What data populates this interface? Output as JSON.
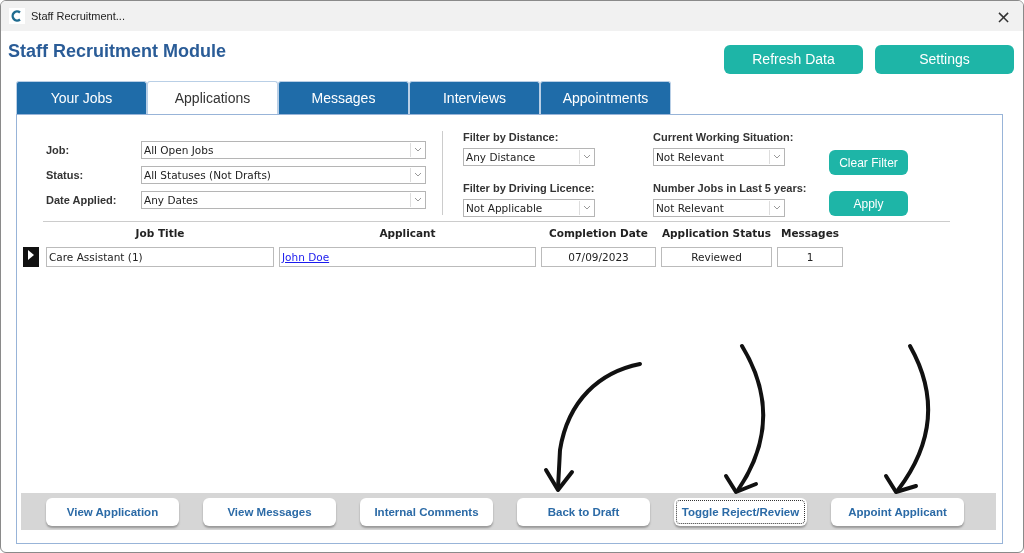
{
  "window": {
    "title": "Staff Recruitment...",
    "close": "×"
  },
  "header": {
    "title": "Staff Recruitment Module",
    "buttons": [
      "Refresh Data",
      "Settings"
    ]
  },
  "tabs": [
    {
      "label": "Your Jobs",
      "selected": false
    },
    {
      "label": "Applications",
      "selected": true
    },
    {
      "label": "Messages",
      "selected": false
    },
    {
      "label": "Interviews",
      "selected": false
    },
    {
      "label": "Appointments",
      "selected": false
    }
  ],
  "filters": {
    "main": [
      {
        "label": "Job:",
        "value": "All Open Jobs"
      },
      {
        "label": "Status:",
        "value": "All Statuses (Not Drafts)"
      },
      {
        "label": "Date Applied:",
        "value": "Any Dates"
      }
    ],
    "column_2": [
      {
        "label": "Filter by Distance:",
        "value": "Any Distance"
      },
      {
        "label": "Filter by Driving Licence:",
        "value": "Not Applicable"
      }
    ],
    "column_3": [
      {
        "label": "Current Working Situation:",
        "value": "Not Relevant"
      },
      {
        "label": "Number Jobs in Last 5 years:",
        "value": "Not Relevant"
      }
    ],
    "buttons": [
      "Clear Filter",
      "Apply"
    ]
  },
  "table": {
    "columns": [
      "Job Title",
      "Applicant",
      "Completion Date",
      "Application Status",
      "Messages"
    ],
    "rows": [
      {
        "current": true,
        "job_title": "Care Assistant (1)",
        "applicant": "John Doe",
        "completion_date": "07/09/2023",
        "application_status": "Reviewed",
        "messages": "1"
      }
    ]
  },
  "actions": [
    {
      "label": "View Application",
      "focused": false
    },
    {
      "label": "View Messages",
      "focused": false
    },
    {
      "label": "Internal Comments",
      "focused": false
    },
    {
      "label": "Back to Draft",
      "focused": false
    },
    {
      "label": "Toggle Reject/Review",
      "focused": true
    },
    {
      "label": "Appoint Applicant",
      "focused": false
    }
  ],
  "annotations": [
    {
      "kind": "arrow"
    },
    {
      "kind": "arrow"
    },
    {
      "kind": "arrow"
    }
  ]
}
